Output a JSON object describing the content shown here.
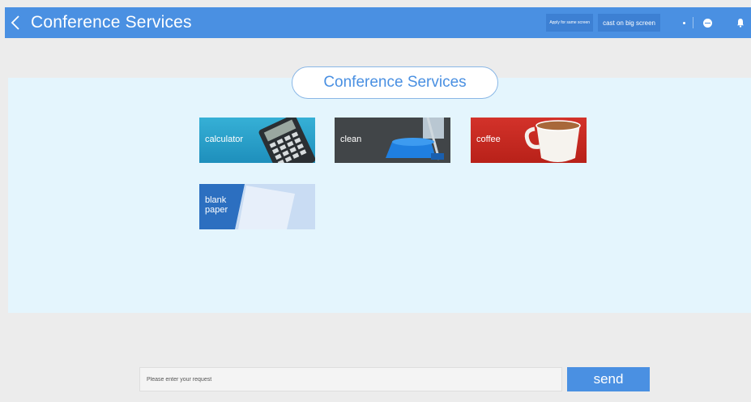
{
  "header": {
    "title": "Conference Services",
    "back_icon": "chevron-left-icon",
    "apply_label": "Apply for same screen",
    "cast_label": "cast on big screen",
    "minus_icon": "minus-circle-icon",
    "bell_icon": "bell-icon"
  },
  "main": {
    "heading": "Conference Services",
    "services": [
      {
        "label": "calculator",
        "icon": "calculator-icon",
        "color": "#2a9fcc"
      },
      {
        "label": "clean",
        "icon": "dustpan-broom-icon",
        "color": "#414548"
      },
      {
        "label": "coffee",
        "icon": "coffee-cup-icon",
        "color": "#c72a22"
      },
      {
        "label": "blank paper",
        "label_lines": [
          "blank",
          "paper"
        ],
        "icon": "paper-icon",
        "color": "#2c6fc0"
      }
    ]
  },
  "footer": {
    "input_placeholder": "Please enter your request",
    "input_value": "",
    "send_label": "send"
  },
  "colors": {
    "accent": "#4a90e2",
    "panel": "#e4f5fd",
    "background": "#ececec"
  }
}
